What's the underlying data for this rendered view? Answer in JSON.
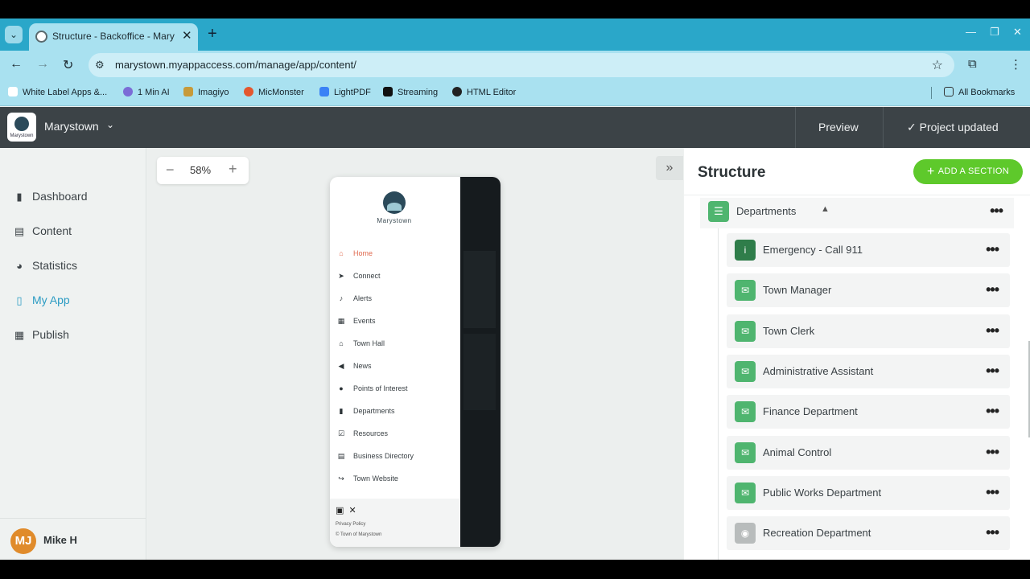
{
  "browser": {
    "tab_title": "Structure - Backoffice - Marystown",
    "url": "marystown.myappaccess.com/manage/app/content/",
    "bookmarks": [
      "White Label Apps &...",
      "1 Min AI",
      "Imagiyo",
      "MicMonster",
      "LightPDF",
      "Streaming",
      "HTML Editor"
    ],
    "all_bookmarks": "All Bookmarks"
  },
  "header": {
    "app_name": "Marystown",
    "logo_text": "Marystown",
    "preview": "Preview",
    "status": "Project updated"
  },
  "sidebar": {
    "items": [
      {
        "label": "Dashboard",
        "icon": "bar-chart-icon"
      },
      {
        "label": "Content",
        "icon": "document-icon"
      },
      {
        "label": "Statistics",
        "icon": "pie-chart-icon"
      },
      {
        "label": "My App",
        "icon": "phone-icon"
      },
      {
        "label": "Publish",
        "icon": "store-icon"
      }
    ],
    "user": {
      "initials": "MJ",
      "name": "Mike H"
    }
  },
  "canvas": {
    "zoom": "58%"
  },
  "phone": {
    "brand": "Marystown",
    "menu": [
      "Home",
      "Connect",
      "Alerts",
      "Events",
      "Town Hall",
      "News",
      "Points of Interest",
      "Departments",
      "Resources",
      "Business Directory",
      "Town Website"
    ],
    "privacy": "Privacy Policy",
    "copyright": "© Town of Marystown"
  },
  "structure": {
    "title": "Structure",
    "add_section": "ADD A SECTION",
    "section": "Departments",
    "children": [
      "Emergency - Call 911",
      "Town Manager",
      "Town Clerk",
      "Administrative Assistant",
      "Finance Department",
      "Animal Control",
      "Public Works Department",
      "Recreation Department"
    ]
  },
  "colors": {
    "accent": "#2a9bc3",
    "add_button": "#5ec92b",
    "section_icon": "#4fb56f",
    "header_bg": "#3c4347"
  }
}
